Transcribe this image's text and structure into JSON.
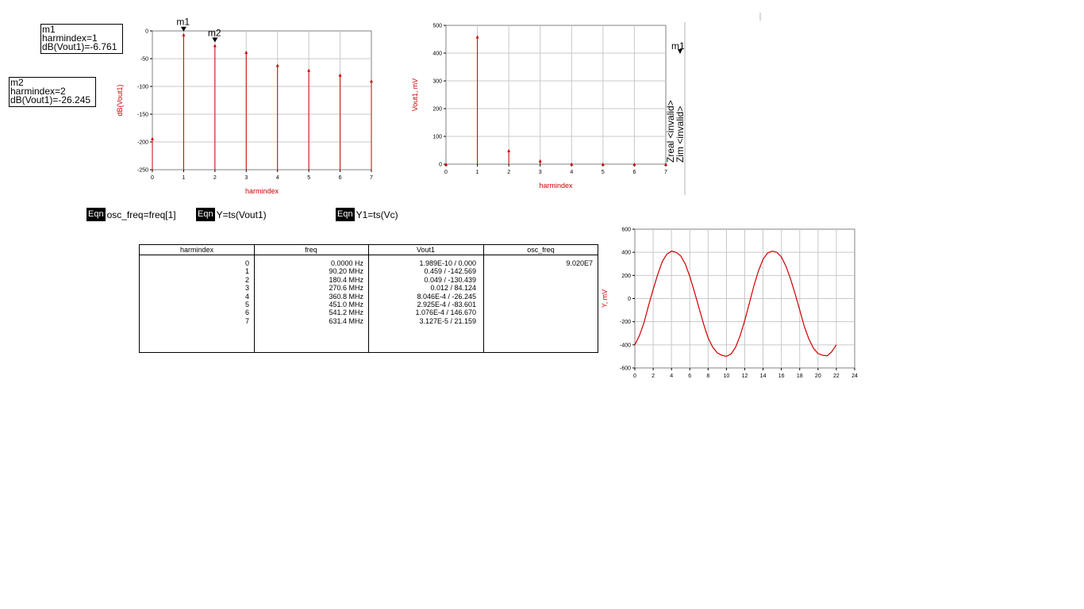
{
  "markers": {
    "m1": {
      "name": "m1",
      "line1": "harmindex=1",
      "line2": "dB(Vout1)=-6.761"
    },
    "m2": {
      "name": "m2",
      "line1": "harmindex=2",
      "line2": "dB(Vout1)=-26.245"
    }
  },
  "equations": [
    {
      "badge": "Eqn",
      "text": "osc_freq=freq[1]"
    },
    {
      "badge": "Eqn",
      "text": "Y=ts(Vout1)"
    },
    {
      "badge": "Eqn",
      "text": "Y1=ts(Vc)"
    }
  ],
  "side_labels": {
    "zreal": "Zreal <invalid>",
    "zim": "Zim <invalid>",
    "marker": "m1"
  },
  "table": {
    "headers": [
      "harmindex",
      "freq",
      "Vout1",
      "osc_freq"
    ],
    "harmindex": [
      "0",
      "1",
      "2",
      "3",
      "4",
      "5",
      "6",
      "7"
    ],
    "freq": [
      "0.0000 Hz",
      "90.20 MHz",
      "180.4 MHz",
      "270.6 MHz",
      "360.8 MHz",
      "451.0 MHz",
      "541.2 MHz",
      "631.4 MHz"
    ],
    "vout1": [
      "1.989E-10 / 0.000",
      "0.459 / -142.569",
      "0.049 / -130.439",
      "0.012 / 84.124",
      "8.046E-4 / -26.245",
      "2.925E-4 / -83.601",
      "1.076E-4 / 146.670",
      "3.127E-5 / 21.159"
    ],
    "osc_freq": [
      "9.020E7"
    ]
  },
  "chart_data": [
    {
      "type": "scatter",
      "style": "stem",
      "xlabel": "harmindex",
      "ylabel": "dB(Vout1)",
      "xlim": [
        0,
        7
      ],
      "ylim": [
        -250,
        0
      ],
      "xticks": [
        "0",
        "1",
        "2",
        "3",
        "4",
        "5",
        "6",
        "7"
      ],
      "yticks": [
        "0",
        "-50",
        "-100",
        "-150",
        "-200",
        "-250"
      ],
      "x": [
        0,
        1,
        2,
        3,
        4,
        5,
        6,
        7
      ],
      "y": [
        -194,
        -6.761,
        -26.245,
        -38.4,
        -61.9,
        -70.7,
        -79.4,
        -90.1
      ],
      "markers": [
        {
          "name": "m1",
          "x": 1
        },
        {
          "name": "m2",
          "x": 2
        }
      ],
      "color": "#cc0000"
    },
    {
      "type": "scatter",
      "style": "stem",
      "xlabel": "harmindex",
      "ylabel": "Vout1, mV",
      "xlim": [
        0,
        7
      ],
      "ylim": [
        0,
        500
      ],
      "xticks": [
        "0",
        "1",
        "2",
        "3",
        "4",
        "5",
        "6",
        "7"
      ],
      "yticks": [
        "500",
        "400",
        "300",
        "200",
        "100",
        "0"
      ],
      "x": [
        0,
        1,
        2,
        3,
        4,
        5,
        6,
        7
      ],
      "y": [
        0,
        459,
        49,
        12,
        0.8,
        0.3,
        0.1,
        0.03
      ],
      "color": "#cc0000"
    },
    {
      "type": "line",
      "xlabel": "",
      "ylabel": "Y, mV",
      "xlim": [
        0,
        24
      ],
      "ylim": [
        -600,
        600
      ],
      "xticks": [
        "0",
        "2",
        "4",
        "6",
        "8",
        "10",
        "12",
        "14",
        "16",
        "18",
        "20",
        "22",
        "24"
      ],
      "yticks": [
        "600",
        "400",
        "200",
        "0",
        "-200",
        "-400",
        "-600"
      ],
      "x": [
        0,
        0.5,
        1,
        1.5,
        2,
        2.5,
        3,
        3.5,
        4,
        4.5,
        5,
        5.5,
        6,
        6.5,
        7,
        7.5,
        8,
        8.5,
        9,
        9.5,
        10,
        10.5,
        11,
        11.5,
        12,
        12.5,
        13,
        13.5,
        14,
        14.5,
        15,
        15.5,
        16,
        16.5,
        17,
        17.5,
        18,
        18.5,
        19,
        19.5,
        20,
        20.5,
        21,
        21.5,
        22
      ],
      "y": [
        -400,
        -320,
        -210,
        -60,
        80,
        210,
        320,
        385,
        410,
        400,
        370,
        300,
        190,
        60,
        -80,
        -220,
        -340,
        -420,
        -470,
        -490,
        -500,
        -480,
        -420,
        -320,
        -190,
        -40,
        110,
        240,
        340,
        395,
        410,
        400,
        360,
        280,
        170,
        40,
        -100,
        -240,
        -350,
        -430,
        -475,
        -490,
        -495,
        -460,
        -400
      ],
      "color": "#cc0000"
    }
  ]
}
